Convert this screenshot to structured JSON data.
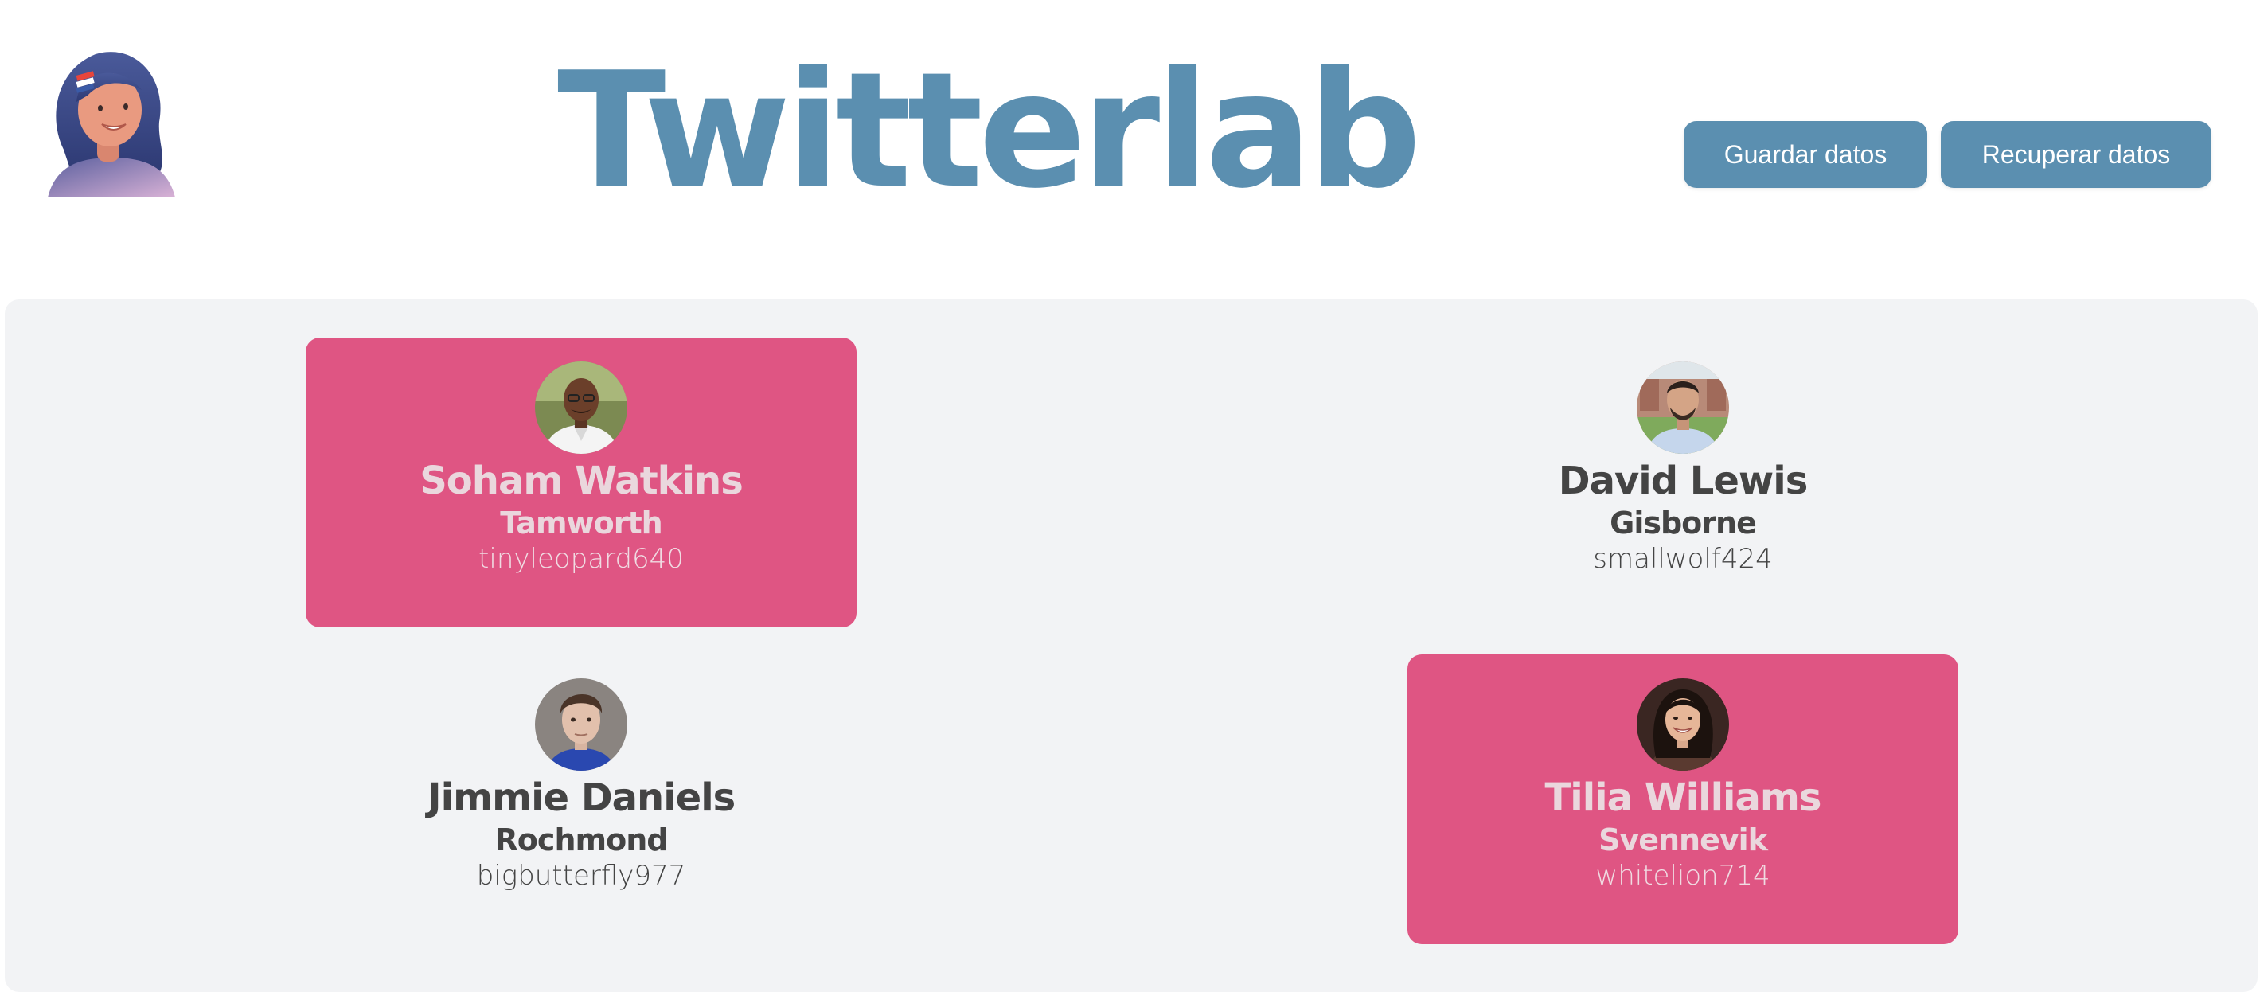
{
  "header": {
    "logo_icon": "woman-avatar-logo-icon",
    "title": "Twitterlab",
    "save_label": "Guardar datos",
    "load_label": "Recuperar datos"
  },
  "colors": {
    "accent": "#5b8fb0",
    "selected_card": "#df5583",
    "board_background": "#f2f3f5",
    "text_dark": "#444444"
  },
  "users": [
    {
      "name": "Soham Watkins",
      "city": "Tamworth",
      "handle": "tinyleopard640",
      "selected": true,
      "avatar_icon": "man-photo-avatar"
    },
    {
      "name": "David Lewis",
      "city": "Gisborne",
      "handle": "smallwolf424",
      "selected": false,
      "avatar_icon": "man-photo-avatar"
    },
    {
      "name": "Jimmie Daniels",
      "city": "Rochmond",
      "handle": "bigbutterfly977",
      "selected": false,
      "avatar_icon": "man-photo-avatar"
    },
    {
      "name": "Tilia Williams",
      "city": "Svennevik",
      "handle": "whitelion714",
      "selected": true,
      "avatar_icon": "woman-photo-avatar"
    }
  ]
}
